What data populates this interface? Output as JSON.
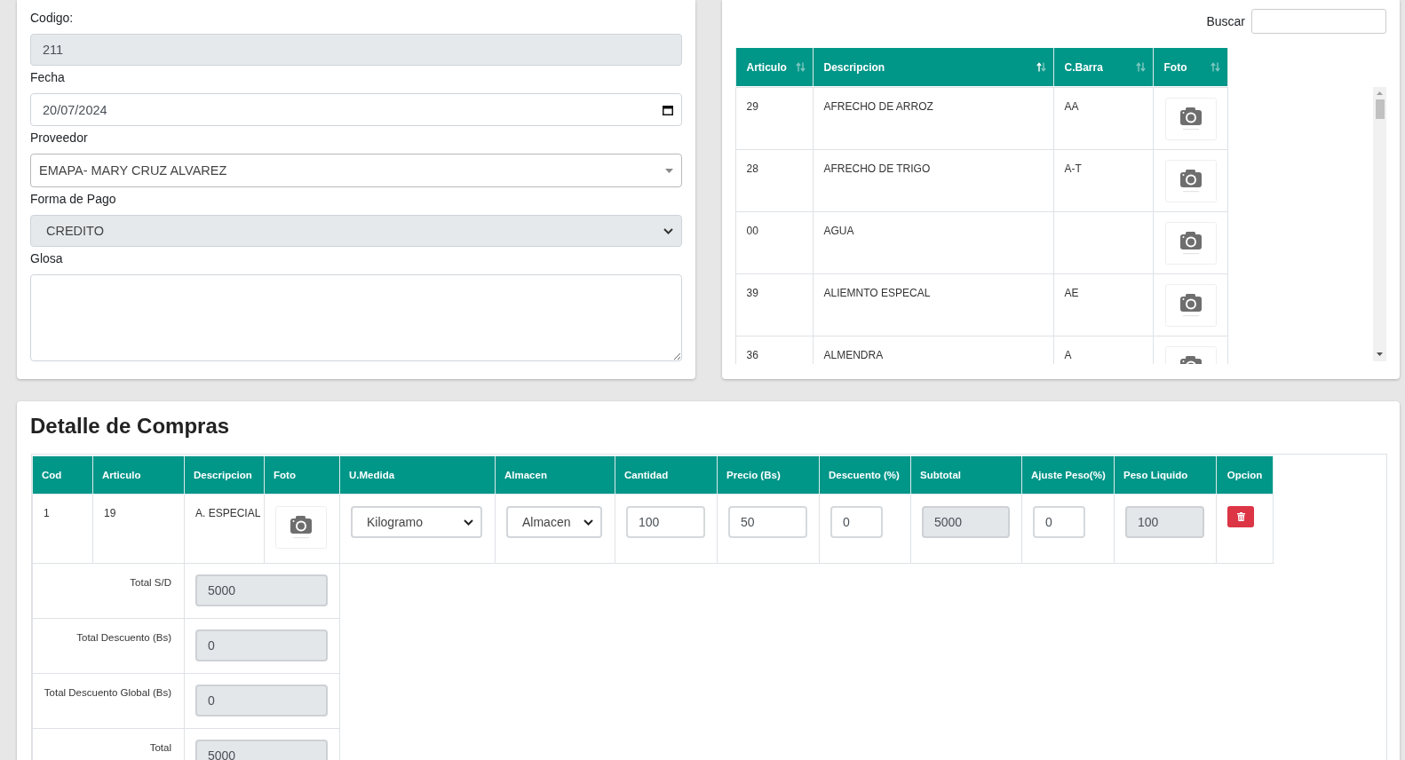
{
  "purchase_form": {
    "fields": [
      {
        "kind": "text",
        "label": "Codigo:",
        "value": "211",
        "disabled": true
      },
      {
        "kind": "date",
        "label": "Fecha",
        "value": "20/07/2024",
        "disabled": false
      },
      {
        "kind": "combo",
        "label": "Proveedor",
        "value": "EMAPA- MARY CRUZ ALVAREZ",
        "disabled": false
      },
      {
        "kind": "select",
        "label": "Forma de Pago",
        "value": "CREDITO",
        "disabled": true
      },
      {
        "kind": "textarea",
        "label": "Glosa",
        "disabled": false
      }
    ]
  },
  "article_search": {
    "search_label": "Buscar",
    "columns": [
      {
        "label": "Articulo",
        "sorted": false
      },
      {
        "label": "Descripcion",
        "sorted": true
      },
      {
        "label": "C.Barra",
        "sorted": false
      },
      {
        "label": "Foto",
        "sorted": false
      }
    ],
    "rows": [
      {
        "articulo": "29",
        "descripcion": "AFRECHO DE ARROZ",
        "c_barra": "AA"
      },
      {
        "articulo": "28",
        "descripcion": "AFRECHO DE TRIGO",
        "c_barra": "A-T"
      },
      {
        "articulo": "00",
        "descripcion": "AGUA"
      },
      {
        "articulo": "39",
        "descripcion": "ALIEMNTO ESPECAL",
        "c_barra": "AE"
      },
      {
        "articulo": "36",
        "descripcion": "ALMENDRA",
        "c_barra": "A"
      }
    ]
  },
  "purchase_detail": {
    "title": "Detalle de Compras",
    "columns": [
      "Cod",
      "Articulo",
      "Descripcion",
      "Foto",
      "U.Medida",
      "Almacen",
      "Cantidad",
      "Precio (Bs)",
      "Descuento (%)",
      "Subtotal",
      "Ajuste Peso(%)",
      "Peso Liquido",
      "Opcion"
    ],
    "rows": [
      {
        "cells": [
          {
            "kind": "text",
            "value": "1"
          },
          {
            "kind": "text",
            "value": "19"
          },
          {
            "kind": "text",
            "value": "A. ESPECIAL"
          },
          {
            "kind": "photo"
          },
          {
            "kind": "select",
            "value": "Kilogramo"
          },
          {
            "kind": "select",
            "value": "Almacen"
          },
          {
            "kind": "input",
            "value": "100",
            "readonly": false
          },
          {
            "kind": "input",
            "value": "50",
            "readonly": false
          },
          {
            "kind": "input",
            "value": "0",
            "readonly": false
          },
          {
            "kind": "input",
            "value": "5000",
            "readonly": true
          },
          {
            "kind": "input",
            "value": "0",
            "readonly": false
          },
          {
            "kind": "input",
            "value": "100",
            "readonly": true
          },
          {
            "kind": "delete"
          }
        ]
      }
    ],
    "totals": [
      {
        "label": "Total S/D",
        "value": "5000",
        "readonly": true
      },
      {
        "label": "Total Descuento (Bs)",
        "value": "0",
        "readonly": true
      },
      {
        "label": "Total Descuento Global (Bs)",
        "value": "0",
        "readonly": true
      },
      {
        "label": "Total",
        "value": "5000",
        "readonly": true
      }
    ]
  }
}
